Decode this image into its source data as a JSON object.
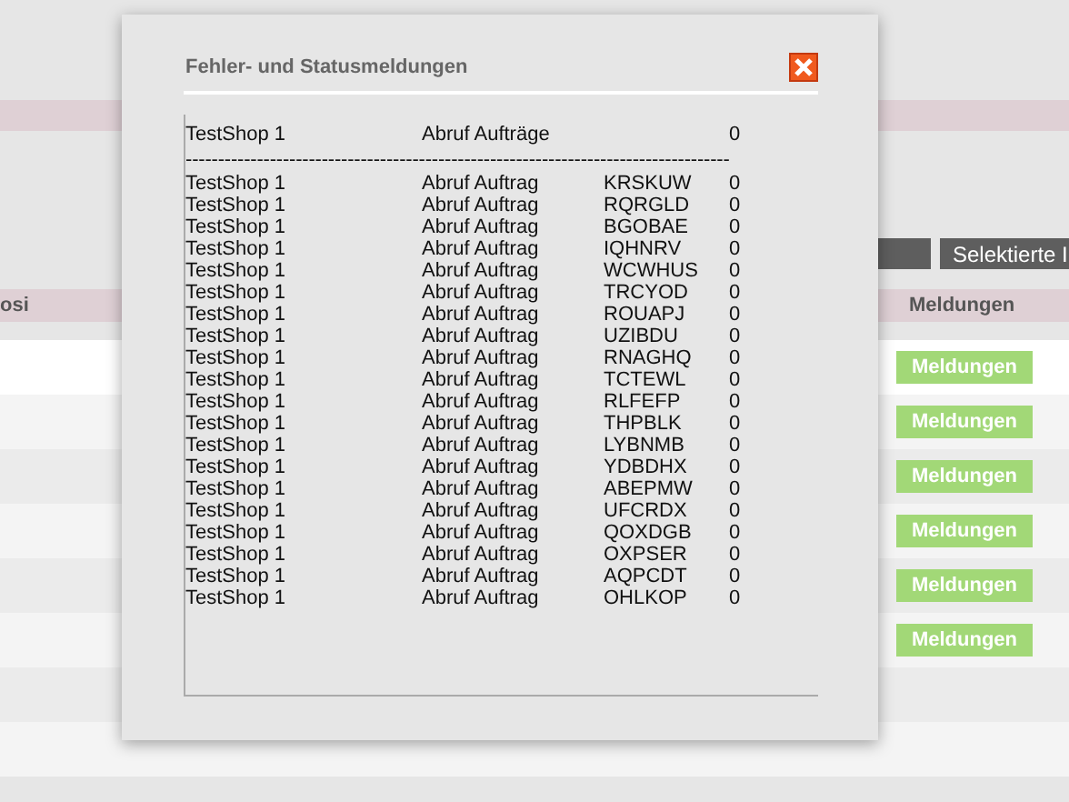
{
  "background_toolbar": {
    "buttons": [
      {
        "kind": "blank"
      },
      {
        "kind": "text",
        "label": "Selektierte I"
      }
    ]
  },
  "background_table": {
    "columns": [
      "osi",
      "Meldungen"
    ],
    "rows": [
      {
        "action": "Meldungen"
      },
      {
        "action": "Meldungen"
      },
      {
        "action": "Meldungen"
      },
      {
        "action": "Meldungen"
      },
      {
        "action": "Meldungen"
      },
      {
        "action": "Meldungen"
      }
    ]
  },
  "dialog": {
    "title": "Fehler- und Statusmeldungen",
    "log": [
      {
        "kind": "entry",
        "shop": "TestShop 1",
        "action": "Abruf Aufträge",
        "count": "0"
      },
      {
        "kind": "separator",
        "text": "------------------------------------------------------------------------------------"
      },
      {
        "kind": "entry",
        "shop": "TestShop 1",
        "action": "Abruf Auftrag",
        "code": "KRSKUW",
        "count": "0"
      },
      {
        "kind": "entry",
        "shop": "TestShop 1",
        "action": "Abruf Auftrag",
        "code": "RQRGLD",
        "count": "0"
      },
      {
        "kind": "entry",
        "shop": "TestShop 1",
        "action": "Abruf Auftrag",
        "code": "BGOBAE",
        "count": "0"
      },
      {
        "kind": "entry",
        "shop": "TestShop 1",
        "action": "Abruf Auftrag",
        "code": "IQHNRV",
        "count": "0"
      },
      {
        "kind": "entry",
        "shop": "TestShop 1",
        "action": "Abruf Auftrag",
        "code": "WCWHUS",
        "count": "0"
      },
      {
        "kind": "entry",
        "shop": "TestShop 1",
        "action": "Abruf Auftrag",
        "code": "TRCYOD",
        "count": "0"
      },
      {
        "kind": "entry",
        "shop": "TestShop 1",
        "action": "Abruf Auftrag",
        "code": "ROUAPJ",
        "count": "0"
      },
      {
        "kind": "entry",
        "shop": "TestShop 1",
        "action": "Abruf Auftrag",
        "code": "UZIBDU",
        "count": "0"
      },
      {
        "kind": "entry",
        "shop": "TestShop 1",
        "action": "Abruf Auftrag",
        "code": "RNAGHQ",
        "count": "0"
      },
      {
        "kind": "entry",
        "shop": "TestShop 1",
        "action": "Abruf Auftrag",
        "code": "TCTEWL",
        "count": "0"
      },
      {
        "kind": "entry",
        "shop": "TestShop 1",
        "action": "Abruf Auftrag",
        "code": "RLFEFP",
        "count": "0"
      },
      {
        "kind": "entry",
        "shop": "TestShop 1",
        "action": "Abruf Auftrag",
        "code": "THPBLK",
        "count": "0"
      },
      {
        "kind": "entry",
        "shop": "TestShop 1",
        "action": "Abruf Auftrag",
        "code": "LYBNMB",
        "count": "0"
      },
      {
        "kind": "entry",
        "shop": "TestShop 1",
        "action": "Abruf Auftrag",
        "code": "YDBDHX",
        "count": "0"
      },
      {
        "kind": "entry",
        "shop": "TestShop 1",
        "action": "Abruf Auftrag",
        "code": "ABEPMW",
        "count": "0"
      },
      {
        "kind": "entry",
        "shop": "TestShop 1",
        "action": "Abruf Auftrag",
        "code": "UFCRDX",
        "count": "0"
      },
      {
        "kind": "entry",
        "shop": "TestShop 1",
        "action": "Abruf Auftrag",
        "code": "QOXDGB",
        "count": "0"
      },
      {
        "kind": "entry",
        "shop": "TestShop 1",
        "action": "Abruf Auftrag",
        "code": "OXPSER",
        "count": "0"
      },
      {
        "kind": "entry",
        "shop": "TestShop 1",
        "action": "Abruf Auftrag",
        "code": "AQPCDT",
        "count": "0"
      },
      {
        "kind": "entry",
        "shop": "TestShop 1",
        "action": "Abruf Auftrag",
        "code": "OHLKOP",
        "count": "0"
      }
    ]
  }
}
